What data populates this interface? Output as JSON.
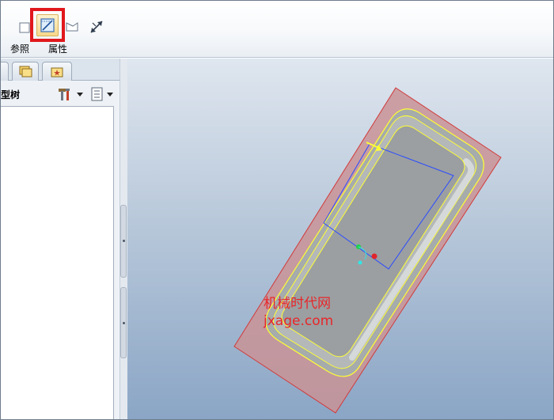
{
  "toolbar": {
    "references_label": "参照",
    "properties_label": "属性"
  },
  "navigator": {
    "tree_title": "型树"
  },
  "watermark": {
    "line1": "机械时代网",
    "line2": "jxage.com"
  },
  "icons": {
    "references": "sketch-plane-icon",
    "properties": "sketch-properties-icon",
    "flip": "flip-direction-icon",
    "model_tree_tab": "model-tree-tab-icon",
    "folder_tab": "folder-browser-tab-icon",
    "favorites_tab": "favorites-tab-icon",
    "settings": "settings-tools-icon",
    "show": "show-list-icon"
  },
  "colors": {
    "highlight": "#e0181c",
    "watermark": "#e8262a",
    "sketch_plane": "#c87a80",
    "edges": "#ffff00",
    "sketch_lines": "#2b4bff"
  }
}
